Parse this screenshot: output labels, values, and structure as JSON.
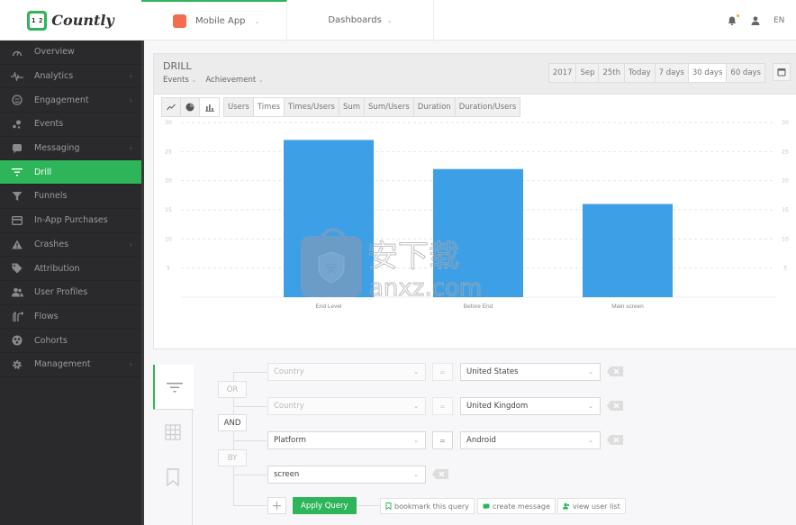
{
  "header": {
    "logo_text": "Countly",
    "app_selector": {
      "label": "Mobile App",
      "swatch_color": "#f26c4f"
    },
    "dashboards_label": "Dashboards",
    "notification_dot_color": "#f5a623",
    "language": "EN"
  },
  "sidebar": {
    "items": [
      {
        "label": "Overview",
        "icon": "gauge-icon",
        "has_submenu": false,
        "active": false
      },
      {
        "label": "Analytics",
        "icon": "pulse-icon",
        "has_submenu": true,
        "active": false
      },
      {
        "label": "Engagement",
        "icon": "smile-icon",
        "has_submenu": true,
        "active": false
      },
      {
        "label": "Events",
        "icon": "events-icon",
        "has_submenu": false,
        "active": false
      },
      {
        "label": "Messaging",
        "icon": "chat-icon",
        "has_submenu": true,
        "active": false
      },
      {
        "label": "Drill",
        "icon": "filter-icon",
        "has_submenu": false,
        "active": true
      },
      {
        "label": "Funnels",
        "icon": "funnel-icon",
        "has_submenu": false,
        "active": false
      },
      {
        "label": "In-App Purchases",
        "icon": "credit-card-icon",
        "has_submenu": false,
        "active": false
      },
      {
        "label": "Crashes",
        "icon": "warning-icon",
        "has_submenu": true,
        "active": false
      },
      {
        "label": "Attribution",
        "icon": "tag-icon",
        "has_submenu": false,
        "active": false
      },
      {
        "label": "User Profiles",
        "icon": "users-icon",
        "has_submenu": false,
        "active": false
      },
      {
        "label": "Flows",
        "icon": "flows-icon",
        "has_submenu": false,
        "active": false
      },
      {
        "label": "Cohorts",
        "icon": "cohorts-icon",
        "has_submenu": false,
        "active": false
      },
      {
        "label": "Management",
        "icon": "gear-icon",
        "has_submenu": true,
        "active": false
      }
    ],
    "arrow": "›"
  },
  "drill": {
    "title": "DRILL",
    "event_type": "Events",
    "event_name": "Achievement",
    "date_presets": [
      "2017",
      "Sep",
      "25th",
      "Today",
      "7 days",
      "30 days",
      "60 days"
    ],
    "active_date": "30 days",
    "chart_types": [
      "line-chart-icon",
      "pie-chart-icon",
      "bar-chart-icon"
    ],
    "active_chart_type": "bar-chart-icon",
    "metrics": [
      "Users",
      "Times",
      "Times/Users",
      "Sum",
      "Sum/Users",
      "Duration",
      "Duration/Users"
    ],
    "active_metric": "Times"
  },
  "chart_data": {
    "type": "bar",
    "title": "",
    "xlabel": "",
    "ylabel": "",
    "categories": [
      "End Level",
      "Before End",
      "Main screen"
    ],
    "values": [
      27,
      22,
      16
    ],
    "ylim": [
      0,
      30
    ],
    "yticks": [
      5,
      10,
      15,
      20,
      25,
      30
    ],
    "grid": true,
    "bar_color": "#3d9fe6",
    "dual_y_axis_labels": true
  },
  "query": {
    "conditions": [
      {
        "property": "Country",
        "operator": "=",
        "value": "United States",
        "disabled": true
      },
      {
        "property": "Country",
        "operator": "=",
        "value": "United Kingdom",
        "disabled": true
      },
      {
        "property": "Platform",
        "operator": "=",
        "value": "Android",
        "disabled": false
      }
    ],
    "logic": {
      "or": "OR",
      "and": "AND",
      "by": "BY"
    },
    "active_logic": "AND",
    "group_by": "screen",
    "apply_label": "Apply Query",
    "add_label": "+",
    "actions": [
      {
        "label": "bookmark this query",
        "icon": "bookmark-icon"
      },
      {
        "label": "create message",
        "icon": "message-icon"
      },
      {
        "label": "view user list",
        "icon": "user-list-icon"
      }
    ]
  },
  "watermark": {
    "text": "anxz.com"
  }
}
